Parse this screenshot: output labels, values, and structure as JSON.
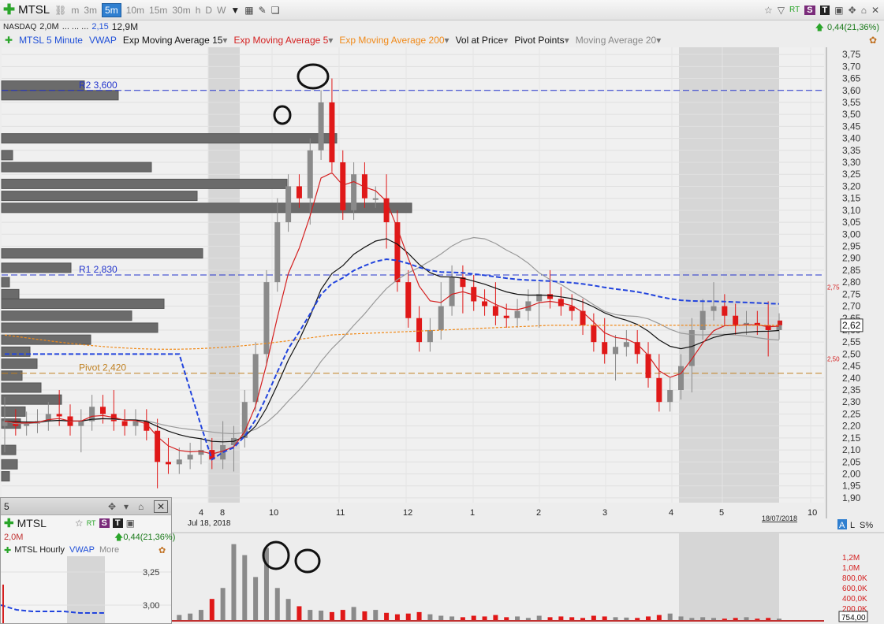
{
  "toolbar": {
    "symbol": "MTSL",
    "intervals": [
      "m",
      "3m",
      "5m",
      "10m",
      "15m",
      "30m",
      "h",
      "D",
      "W"
    ],
    "active_interval": "5m",
    "rt_label": "RT",
    "s_label": "S",
    "t_label": "T"
  },
  "quote": {
    "exchange": "NASDAQ",
    "volume": "2,0M",
    "dots": "... ... ...",
    "price": "2,15",
    "avg_volume": "12,9M",
    "change": "0,44(21,36%)"
  },
  "indicators": [
    {
      "label": "MTSL 5 Minute",
      "color": "#1f4fd8"
    },
    {
      "label": "VWAP",
      "color": "#1f4fd8"
    },
    {
      "label": "Exp Moving Average 15",
      "color": "#111111"
    },
    {
      "label": "Exp Moving Average 5",
      "color": "#d42020"
    },
    {
      "label": "Exp Moving Average 200",
      "color": "#f08a1a"
    },
    {
      "label": "Vol at Price",
      "color": "#111111"
    },
    {
      "label": "Pivot Points",
      "color": "#111111"
    },
    {
      "label": "Moving Average 20",
      "color": "#888888"
    }
  ],
  "pivots": {
    "r2": "R2 3,600",
    "r1": "R1 2,830",
    "pivot": "Pivot 2,420"
  },
  "current_price_label": "2,62",
  "side_markers": {
    "upper": "2,75",
    "lower": "2,50"
  },
  "chart_data": {
    "type": "candlestick",
    "y_axis_ticks": [
      "3,75",
      "3,70",
      "3,65",
      "3,60",
      "3,55",
      "3,50",
      "3,45",
      "3,40",
      "3,35",
      "3,30",
      "3,25",
      "3,20",
      "3,15",
      "3,10",
      "3,05",
      "3,00",
      "2,95",
      "2,90",
      "2,85",
      "2,80",
      "2,75",
      "2,70",
      "2,65",
      "2,60",
      "2,55",
      "2,50",
      "2,45",
      "2,40",
      "2,35",
      "2,30",
      "2,25",
      "2,20",
      "2,15",
      "2,10",
      "2,05",
      "2,00",
      "1,95",
      "1,90"
    ],
    "ylim": [
      1.88,
      3.78
    ],
    "x_axis_labels": [
      "4",
      "8",
      "10",
      "11",
      "12",
      "1",
      "2",
      "3",
      "4",
      "5",
      "10"
    ],
    "x_axis_date": "Jul 18, 2018",
    "x_axis_end_date": "18/07/2018",
    "levels": {
      "r2": 3.6,
      "r1": 2.83,
      "pivot": 2.42
    },
    "price_series_close": [
      2.22,
      2.2,
      2.21,
      2.22,
      2.25,
      2.24,
      2.2,
      2.22,
      2.28,
      2.25,
      2.22,
      2.2,
      2.22,
      2.18,
      2.05,
      2.04,
      2.06,
      2.08,
      2.1,
      2.06,
      2.12,
      2.15,
      2.3,
      2.5,
      2.8,
      3.05,
      3.2,
      3.15,
      3.35,
      3.55,
      3.3,
      3.1,
      3.25,
      3.15,
      3.15,
      3.05,
      2.8,
      2.65,
      2.55,
      2.6,
      2.7,
      2.82,
      2.78,
      2.72,
      2.7,
      2.66,
      2.65,
      2.68,
      2.72,
      2.75,
      2.73,
      2.7,
      2.68,
      2.62,
      2.55,
      2.5,
      2.53,
      2.55,
      2.5,
      2.4,
      2.3,
      2.35,
      2.45,
      2.6,
      2.68,
      2.7,
      2.66,
      2.62,
      2.63,
      2.62,
      2.6,
      2.62
    ],
    "volume_axis_ticks": [
      "1,2M",
      "1,0M",
      "800,0K",
      "600,0K",
      "400,0K",
      "200,0K"
    ],
    "volume_label": "754,00",
    "volume_series": [
      10,
      8,
      12,
      10,
      14,
      9,
      11,
      10,
      12,
      9,
      10,
      8,
      12,
      10,
      14,
      12,
      16,
      20,
      30,
      60,
      90,
      210,
      180,
      120,
      200,
      90,
      60,
      40,
      30,
      28,
      24,
      30,
      38,
      26,
      30,
      22,
      18,
      20,
      24,
      18,
      14,
      12,
      10,
      14,
      12,
      16,
      10,
      12,
      8,
      14,
      10,
      12,
      10,
      8,
      14,
      12,
      10,
      9,
      8,
      12,
      16,
      20,
      12,
      8,
      10,
      8,
      6,
      8,
      10,
      6,
      8,
      6
    ]
  },
  "sub_panel": {
    "number": "5",
    "symbol": "MTSL",
    "volume": "2,0M",
    "change": "0,44(21,36%)",
    "indicators": [
      "MTSL Hourly",
      "VWAP",
      "More"
    ],
    "price_labels": [
      "3,25",
      "3,00"
    ]
  }
}
